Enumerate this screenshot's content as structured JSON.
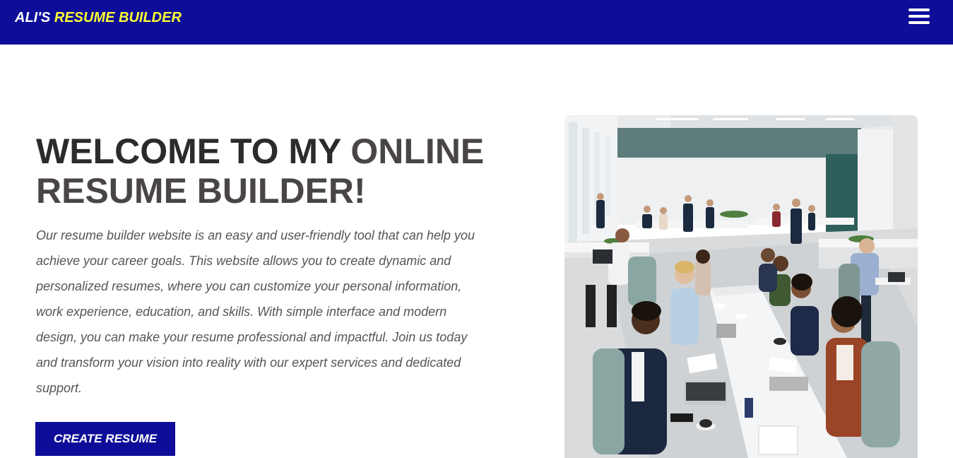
{
  "navbar": {
    "brand_prefix": "ALI'S ",
    "brand_accent": "RESUME BUILDER",
    "menu_icon": "hamburger-menu-icon",
    "bg_color": "#0d0d99",
    "accent_color": "#ffff33"
  },
  "hero": {
    "title_part1": "WELCOME TO MY ",
    "title_part2": "ONLINE RESUME BUILDER!",
    "description": "Our resume builder website is an easy and user-friendly tool that can help you achieve your career goals. This website allows you to create dynamic and personalized resumes, where you can customize your personal information, work experience, education, and skills. With simple interface and modern design, you can make your resume professional and impactful. Join us today and transform your vision into reality with our expert services and dedicated support.",
    "cta_label": "CREATE RESUME"
  }
}
